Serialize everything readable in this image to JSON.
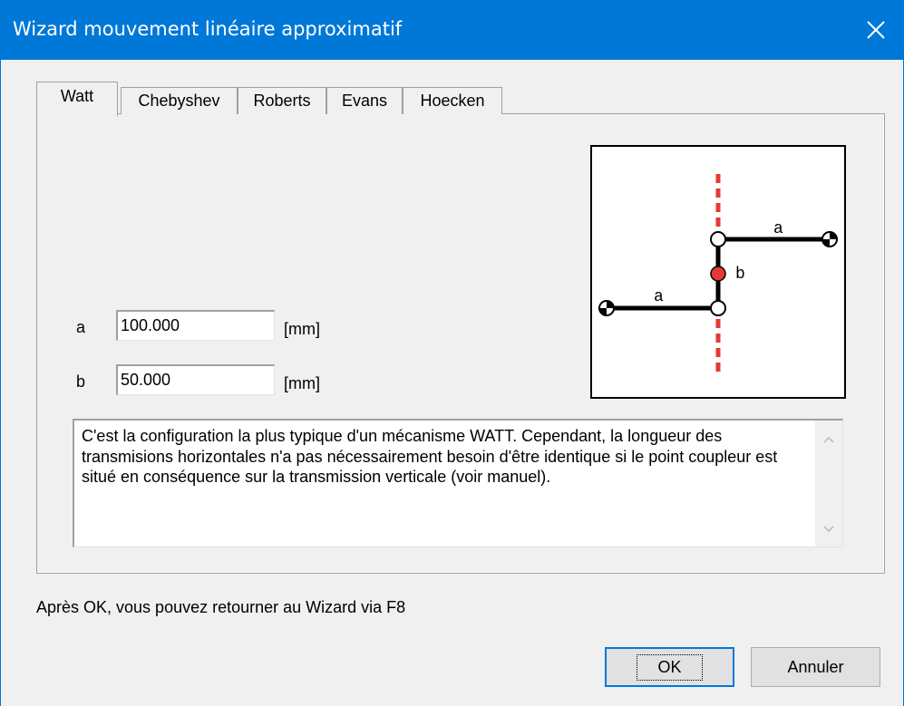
{
  "window": {
    "title": "Wizard mouvement linéaire approximatif",
    "close_icon": "close-icon"
  },
  "tabs": [
    {
      "label": "Watt",
      "active": true
    },
    {
      "label": "Chebyshev",
      "active": false
    },
    {
      "label": "Roberts",
      "active": false
    },
    {
      "label": "Evans",
      "active": false
    },
    {
      "label": "Hoecken",
      "active": false
    }
  ],
  "fields": {
    "a": {
      "label": "a",
      "value": "100.000",
      "unit": "[mm]"
    },
    "b": {
      "label": "b",
      "value": "50.000",
      "unit": "[mm]"
    }
  },
  "diagram": {
    "label_a_top": "a",
    "label_a_bottom": "a",
    "label_b": "b",
    "path_color": "#e53935"
  },
  "description": "C'est la configuration la plus typique d'un mécanisme WATT. Cependant, la longueur des transmisions horizontales n'a pas nécessairement besoin d'être identique si le point coupleur est situé en conséquence sur la transmission verticale (voir manuel).",
  "hint": "Après OK, vous pouvez retourner au Wizard via F8",
  "buttons": {
    "ok": "OK",
    "cancel": "Annuler"
  },
  "colors": {
    "titlebar": "#0078d7",
    "accent": "#0078d7"
  }
}
